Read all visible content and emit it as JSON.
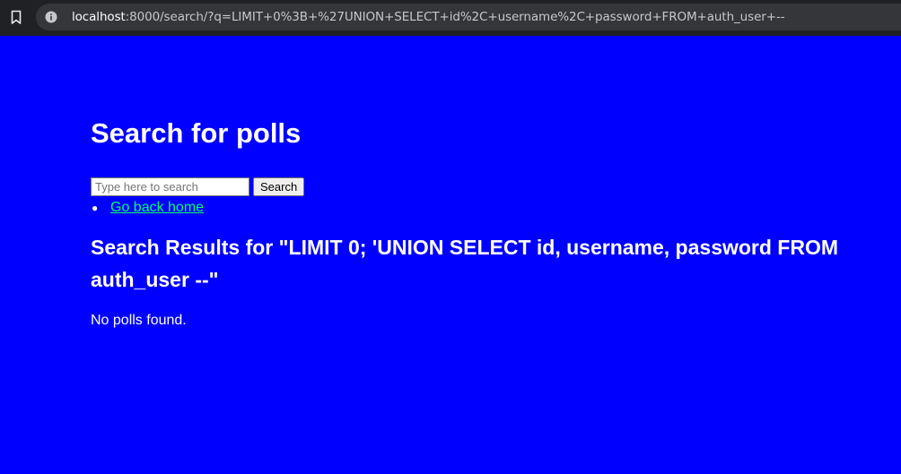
{
  "browser": {
    "url_host": "localhost",
    "url_rest": ":8000/search/?q=LIMIT+0%3B+%27UNION+SELECT+id%2C+username%2C+password+FROM+auth_user+--",
    "bookmark_icon": "bookmark-icon",
    "info_icon": "info-icon"
  },
  "page": {
    "title": "Search for polls",
    "search": {
      "placeholder": "Type here to search",
      "value": "",
      "button_label": "Search"
    },
    "nav": [
      {
        "label": "Go back home"
      }
    ],
    "results_heading": "Search Results for \"LIMIT 0; 'UNION SELECT id, username, password FROM auth_user --\"",
    "empty_message": "No polls found."
  },
  "colors": {
    "page_background": "#0000ff",
    "text": "#ffffff",
    "link": "#00ff66",
    "browser_bar": "#202124",
    "omnibox": "#35363a"
  }
}
